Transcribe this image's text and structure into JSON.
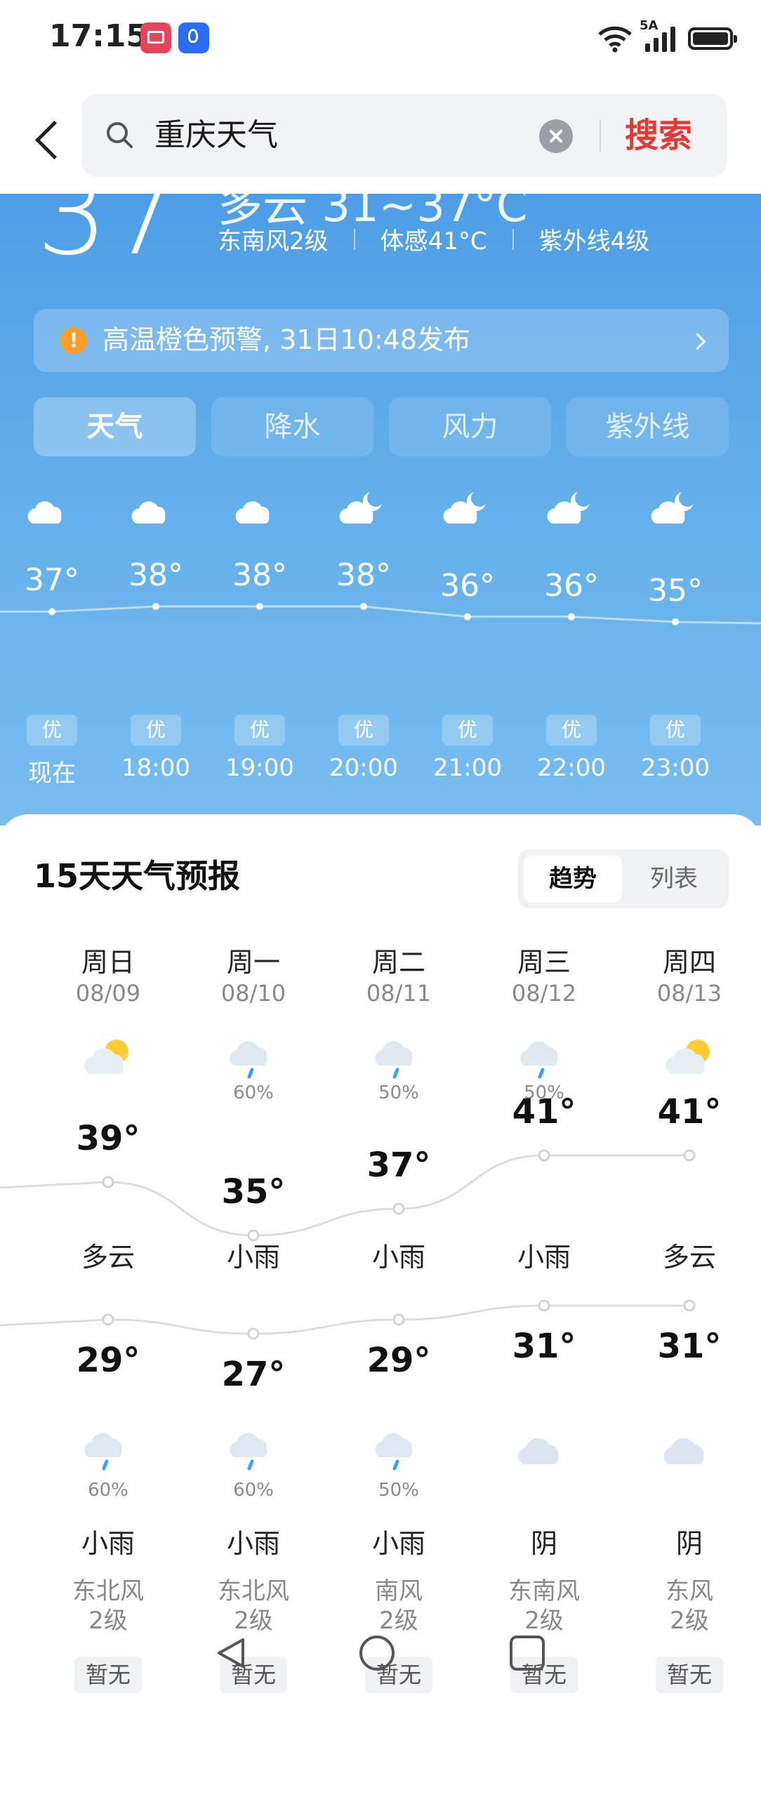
{
  "status_bar": {
    "time": "17:15",
    "network": "5A"
  },
  "search": {
    "query": "重庆天气",
    "button": "搜索"
  },
  "current": {
    "temp": "37",
    "condition_partial": "多云 31~37°C",
    "wind": "东南风2级",
    "feels_like": "体感41°C",
    "uv": "紫外线4级"
  },
  "alert": {
    "text": "高温橙色预警, 31日10:48发布"
  },
  "tabs": [
    "天气",
    "降水",
    "风力",
    "紫外线"
  ],
  "hourly": [
    {
      "time": "现在",
      "temp": "37°",
      "aqi": "优",
      "icon": "cloud-icon"
    },
    {
      "time": "18:00",
      "temp": "38°",
      "aqi": "优",
      "icon": "cloud-icon"
    },
    {
      "time": "19:00",
      "temp": "38°",
      "aqi": "优",
      "icon": "cloud-icon"
    },
    {
      "time": "20:00",
      "temp": "38°",
      "aqi": "优",
      "icon": "moon-cloud-icon"
    },
    {
      "time": "21:00",
      "temp": "36°",
      "aqi": "优",
      "icon": "moon-cloud-icon"
    },
    {
      "time": "22:00",
      "temp": "36°",
      "aqi": "优",
      "icon": "moon-cloud-icon"
    },
    {
      "time": "23:00",
      "temp": "35°",
      "aqi": "优",
      "icon": "moon-cloud-icon"
    }
  ],
  "forecast": {
    "title": "15天天气预报",
    "view_toggle": {
      "trend": "趋势",
      "list": "列表"
    },
    "days": [
      {
        "week": "周日",
        "date": "08/09",
        "day_icon": "partly-cloudy-icon",
        "day_prob": "",
        "day_cond": "多云",
        "high": "39°",
        "low": "29°",
        "night_icon": "rain-cloud-icon",
        "night_prob": "60%",
        "night_cond": "小雨",
        "wind": "东北风",
        "wind_level": "2级",
        "aqi": "暂无"
      },
      {
        "week": "周一",
        "date": "08/10",
        "day_icon": "rain-cloud-icon",
        "day_prob": "60%",
        "day_cond": "小雨",
        "high": "35°",
        "low": "27°",
        "night_icon": "rain-cloud-icon",
        "night_prob": "60%",
        "night_cond": "小雨",
        "wind": "东北风",
        "wind_level": "2级",
        "aqi": "暂无"
      },
      {
        "week": "周二",
        "date": "08/11",
        "day_icon": "rain-cloud-icon",
        "day_prob": "50%",
        "day_cond": "小雨",
        "high": "37°",
        "low": "29°",
        "night_icon": "rain-cloud-icon",
        "night_prob": "50%",
        "night_cond": "小雨",
        "wind": "南风",
        "wind_level": "2级",
        "aqi": "暂无"
      },
      {
        "week": "周三",
        "date": "08/12",
        "day_icon": "rain-cloud-icon",
        "day_prob": "50%",
        "day_cond": "小雨",
        "high": "41°",
        "low": "31°",
        "night_icon": "overcast-cloud-icon",
        "night_prob": "",
        "night_cond": "阴",
        "wind": "东南风",
        "wind_level": "2级",
        "aqi": "暂无"
      },
      {
        "week": "周四",
        "date": "08/13",
        "day_icon": "partly-cloudy-icon",
        "day_prob": "",
        "day_cond": "多云",
        "high": "41°",
        "low": "31°",
        "night_icon": "overcast-cloud-icon",
        "night_prob": "",
        "night_cond": "阴",
        "wind": "东风",
        "wind_level": "2级",
        "aqi": "暂无"
      }
    ]
  },
  "colors": {
    "accent_red": "#e43a35",
    "sky_blue": "#5aa8e8",
    "alert_orange": "#ff9c2a"
  }
}
